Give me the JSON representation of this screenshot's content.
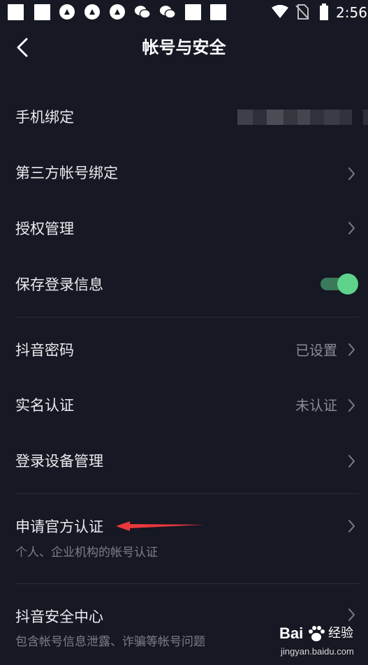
{
  "status_bar": {
    "time": "2:56",
    "left_icons": [
      "notification-square-icon",
      "notification-square-icon",
      "app-circle-icon",
      "app-circle-icon",
      "app-circle-icon",
      "wechat-icon",
      "wechat-icon",
      "notification-square-icon",
      "notification-square-icon"
    ],
    "right_icons": [
      "wifi-icon",
      "no-sim-icon",
      "battery-icon"
    ]
  },
  "nav": {
    "title": "帐号与安全",
    "back_icon": "chevron-left-icon"
  },
  "rows": {
    "phone_binding": {
      "label": "手机绑定"
    },
    "third_party": {
      "label": "第三方帐号绑定"
    },
    "authorization": {
      "label": "授权管理"
    },
    "save_login": {
      "label": "保存登录信息",
      "toggle_on": true
    },
    "password": {
      "label": "抖音密码",
      "value": "已设置"
    },
    "real_name": {
      "label": "实名认证",
      "value": "未认证"
    },
    "devices": {
      "label": "登录设备管理"
    },
    "official_cert": {
      "label": "申请官方认证",
      "sub": "个人、企业机构的帐号认证"
    },
    "security_center": {
      "label": "抖音安全中心",
      "sub": "包含帐号信息泄露、诈骗等帐号问题"
    }
  },
  "annotation": {
    "arrow_color": "#e8383d"
  },
  "watermark": {
    "logo": "Bai",
    "cn": "经验",
    "url": "jingyan.baidu.com"
  },
  "colors": {
    "background": "#161823",
    "toggle_on": "#5fd38c",
    "arrow": "#e8383d"
  }
}
